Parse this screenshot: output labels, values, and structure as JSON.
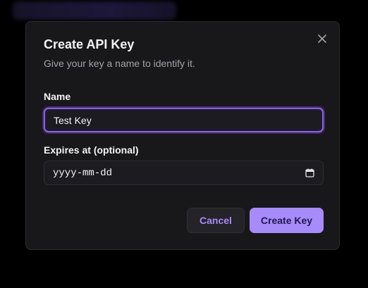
{
  "modal": {
    "title": "Create API Key",
    "subtitle": "Give your key a name to identify it.",
    "close_icon": "x-close-icon"
  },
  "form": {
    "name_label": "Name",
    "name_value": "Test Key",
    "expires_label": "Expires at (optional)",
    "expires_placeholder": "yyyy-mm-dd",
    "calendar_icon": "calendar-icon"
  },
  "actions": {
    "cancel_label": "Cancel",
    "create_label": "Create Key"
  },
  "colors": {
    "accent": "#a78bfa",
    "focus_ring": "#8b5cf6",
    "modal_bg": "#18181b",
    "page_bg": "#000000"
  }
}
